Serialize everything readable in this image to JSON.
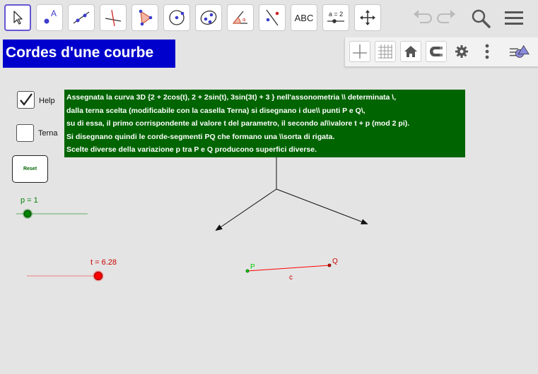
{
  "title": "Cordes d'une courbe",
  "toolbar": {
    "tools": [
      {
        "name": "move-tool-icon"
      },
      {
        "name": "point-tool-icon",
        "letter": "A"
      },
      {
        "name": "line-tool-icon"
      },
      {
        "name": "perpendicular-line-tool-icon"
      },
      {
        "name": "polygon-tool-icon"
      },
      {
        "name": "circle-tool-icon"
      },
      {
        "name": "ellipse-tool-icon"
      },
      {
        "name": "angle-tool-icon"
      },
      {
        "name": "reflect-tool-icon"
      },
      {
        "name": "text-tool-icon",
        "label": "ABC"
      },
      {
        "name": "slider-tool-icon",
        "label": "a = 2"
      },
      {
        "name": "move-graphics-view-tool-icon"
      }
    ],
    "header_icons": [
      "undo-icon",
      "redo-icon",
      "search-icon",
      "menu-icon"
    ]
  },
  "graphics_bar": {
    "icons": [
      "axes-icon",
      "grid-icon",
      "home-icon",
      "point-capturing-icon",
      "settings-icon",
      "more-icon",
      "style-bar-icon"
    ]
  },
  "checkboxes": {
    "help": {
      "label": "Help",
      "checked": true
    },
    "terna": {
      "label": "Terna",
      "checked": false
    }
  },
  "reset_label": "Reset",
  "help_text": [
    "Assegnata la curva 3D  {2 + 2cos(t), 2 + 2sin(t), 3sin(3t) + 3 } nell'assonometria \\\\ determinata \\,",
    "dalla  terna scelta (modificabile con la casella Terna)   si disegnano i due\\\\ punti P e Q\\,",
    "su di essa, il primo corrispondente al valore t del parametro, il secondo al\\\\valore  t + p  (mod 2 pi).",
    "Si disegnano quindi le corde-segmenti PQ che formano una \\\\sorta di rigata.",
    "Scelte diverse della variazione  p  tra P e Q producono superfici diverse."
  ],
  "sliders": {
    "p": {
      "label": "p = 1",
      "value": 1,
      "color": "#008000"
    },
    "t": {
      "label": "t = 6.28",
      "value": 6.28,
      "color": "#ff0000"
    }
  },
  "points": {
    "P": {
      "label": "P",
      "color": "#00cc00"
    },
    "Q": {
      "label": "Q",
      "color": "#cc0000"
    },
    "segment": {
      "label": "c",
      "color": "#ff0000"
    }
  },
  "colors": {
    "accent": "#6557d2",
    "title_bg": "#0000cc",
    "help_bg": "#006400"
  }
}
